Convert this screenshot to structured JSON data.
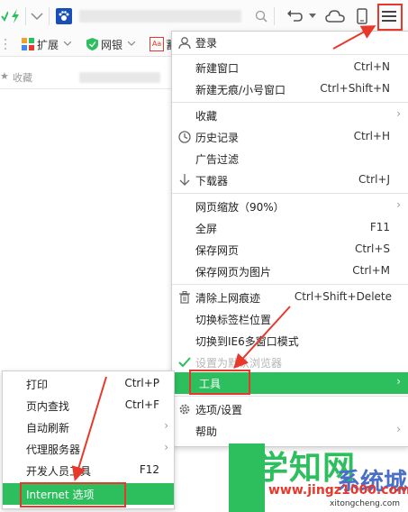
{
  "bookmarks": {
    "extensions_label": "扩展",
    "netbank_label": "网银",
    "more_label": "蓄",
    "favorites_label": "收藏"
  },
  "menu": {
    "items": [
      {
        "label": "登录",
        "shortcut": "",
        "icon": "user-icon"
      },
      {
        "label": "新建窗口",
        "shortcut": "Ctrl+N"
      },
      {
        "label": "新建无痕/小号窗口",
        "shortcut": "Ctrl+Shift+N"
      },
      {
        "label": "收藏",
        "shortcut": "",
        "arrow": true
      },
      {
        "label": "历史记录",
        "shortcut": "Ctrl+H",
        "icon": "clock-icon"
      },
      {
        "label": "广告过滤",
        "shortcut": ""
      },
      {
        "label": "下载器",
        "shortcut": "Ctrl+J",
        "icon": "download-icon"
      },
      {
        "label": "网页缩放（90%）",
        "shortcut": "",
        "arrow": true
      },
      {
        "label": "全屏",
        "shortcut": "F11"
      },
      {
        "label": "保存网页",
        "shortcut": "Ctrl+S"
      },
      {
        "label": "保存网页为图片",
        "shortcut": "Ctrl+M"
      },
      {
        "label": "清除上网痕迹",
        "shortcut": "Ctrl+Shift+Delete",
        "icon": "trash-icon"
      },
      {
        "label": "切换标签栏位置",
        "shortcut": ""
      },
      {
        "label": "切换到IE6多窗口模式",
        "shortcut": ""
      },
      {
        "label": "设置为默认浏览器",
        "shortcut": "",
        "icon": "check-icon"
      },
      {
        "label": "工具",
        "shortcut": "",
        "arrow": true
      },
      {
        "label": "选项/设置",
        "shortcut": "",
        "icon": "gear-icon"
      },
      {
        "label": "帮助",
        "shortcut": "",
        "arrow": true
      }
    ]
  },
  "submenu": {
    "items": [
      {
        "label": "打印",
        "shortcut": "Ctrl+P"
      },
      {
        "label": "页内查找",
        "shortcut": "Ctrl+F"
      },
      {
        "label": "自动刷新",
        "shortcut": "",
        "arrow": true
      },
      {
        "label": "代理服务器",
        "shortcut": "",
        "arrow": true
      },
      {
        "label": "开发人员工具",
        "shortcut": "F12"
      },
      {
        "label": "Internet 选项",
        "shortcut": ""
      }
    ]
  },
  "watermark": {
    "main": "学知网",
    "sub": "系统城",
    "url1": "www.jingz1000.com",
    "url2": "xitongcheng.com"
  },
  "colors": {
    "accent_green": "#2dbf5e",
    "highlight_red": "#e8382c"
  }
}
